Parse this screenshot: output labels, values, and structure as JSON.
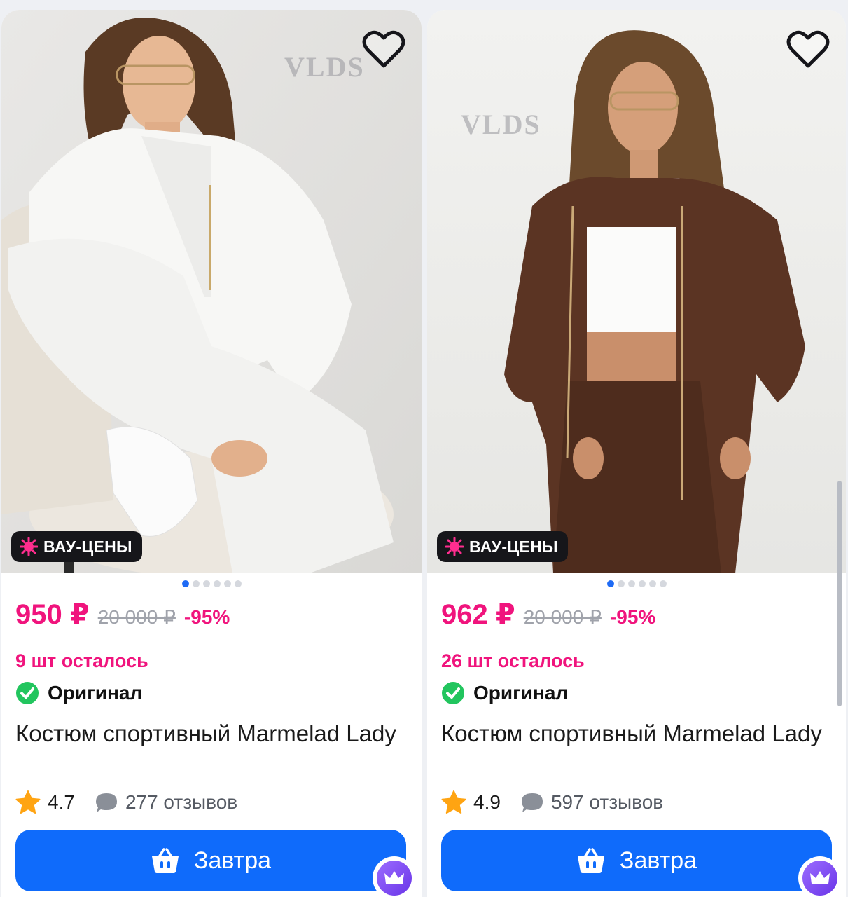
{
  "colors": {
    "accent_pink": "#f0147d",
    "button_blue": "#0f6bfb",
    "dot_active": "#1f6bf5",
    "original_green": "#22c55e",
    "star_orange": "#ffa412"
  },
  "products": [
    {
      "brand_watermark": "VLDS",
      "badge": "ВАУ-ЦЕНЫ",
      "price": "950 ₽",
      "old_price": "20 000 ₽",
      "discount": "-95%",
      "stock": "9 шт осталось",
      "original_label": "Оригинал",
      "title": "Костюм спортивный Marmelad Lady",
      "rating": "4.7",
      "reviews": "277 отзывов",
      "button_label": "Завтра",
      "image_index": 1,
      "image_count": 6
    },
    {
      "brand_watermark": "VLDS",
      "badge": "ВАУ-ЦЕНЫ",
      "price": "962 ₽",
      "old_price": "20 000 ₽",
      "discount": "-95%",
      "stock": "26 шт осталось",
      "original_label": "Оригинал",
      "title": "Костюм спортивный Marmelad Lady",
      "rating": "4.9",
      "reviews": "597 отзывов",
      "button_label": "Завтра",
      "image_index": 1,
      "image_count": 6
    }
  ]
}
